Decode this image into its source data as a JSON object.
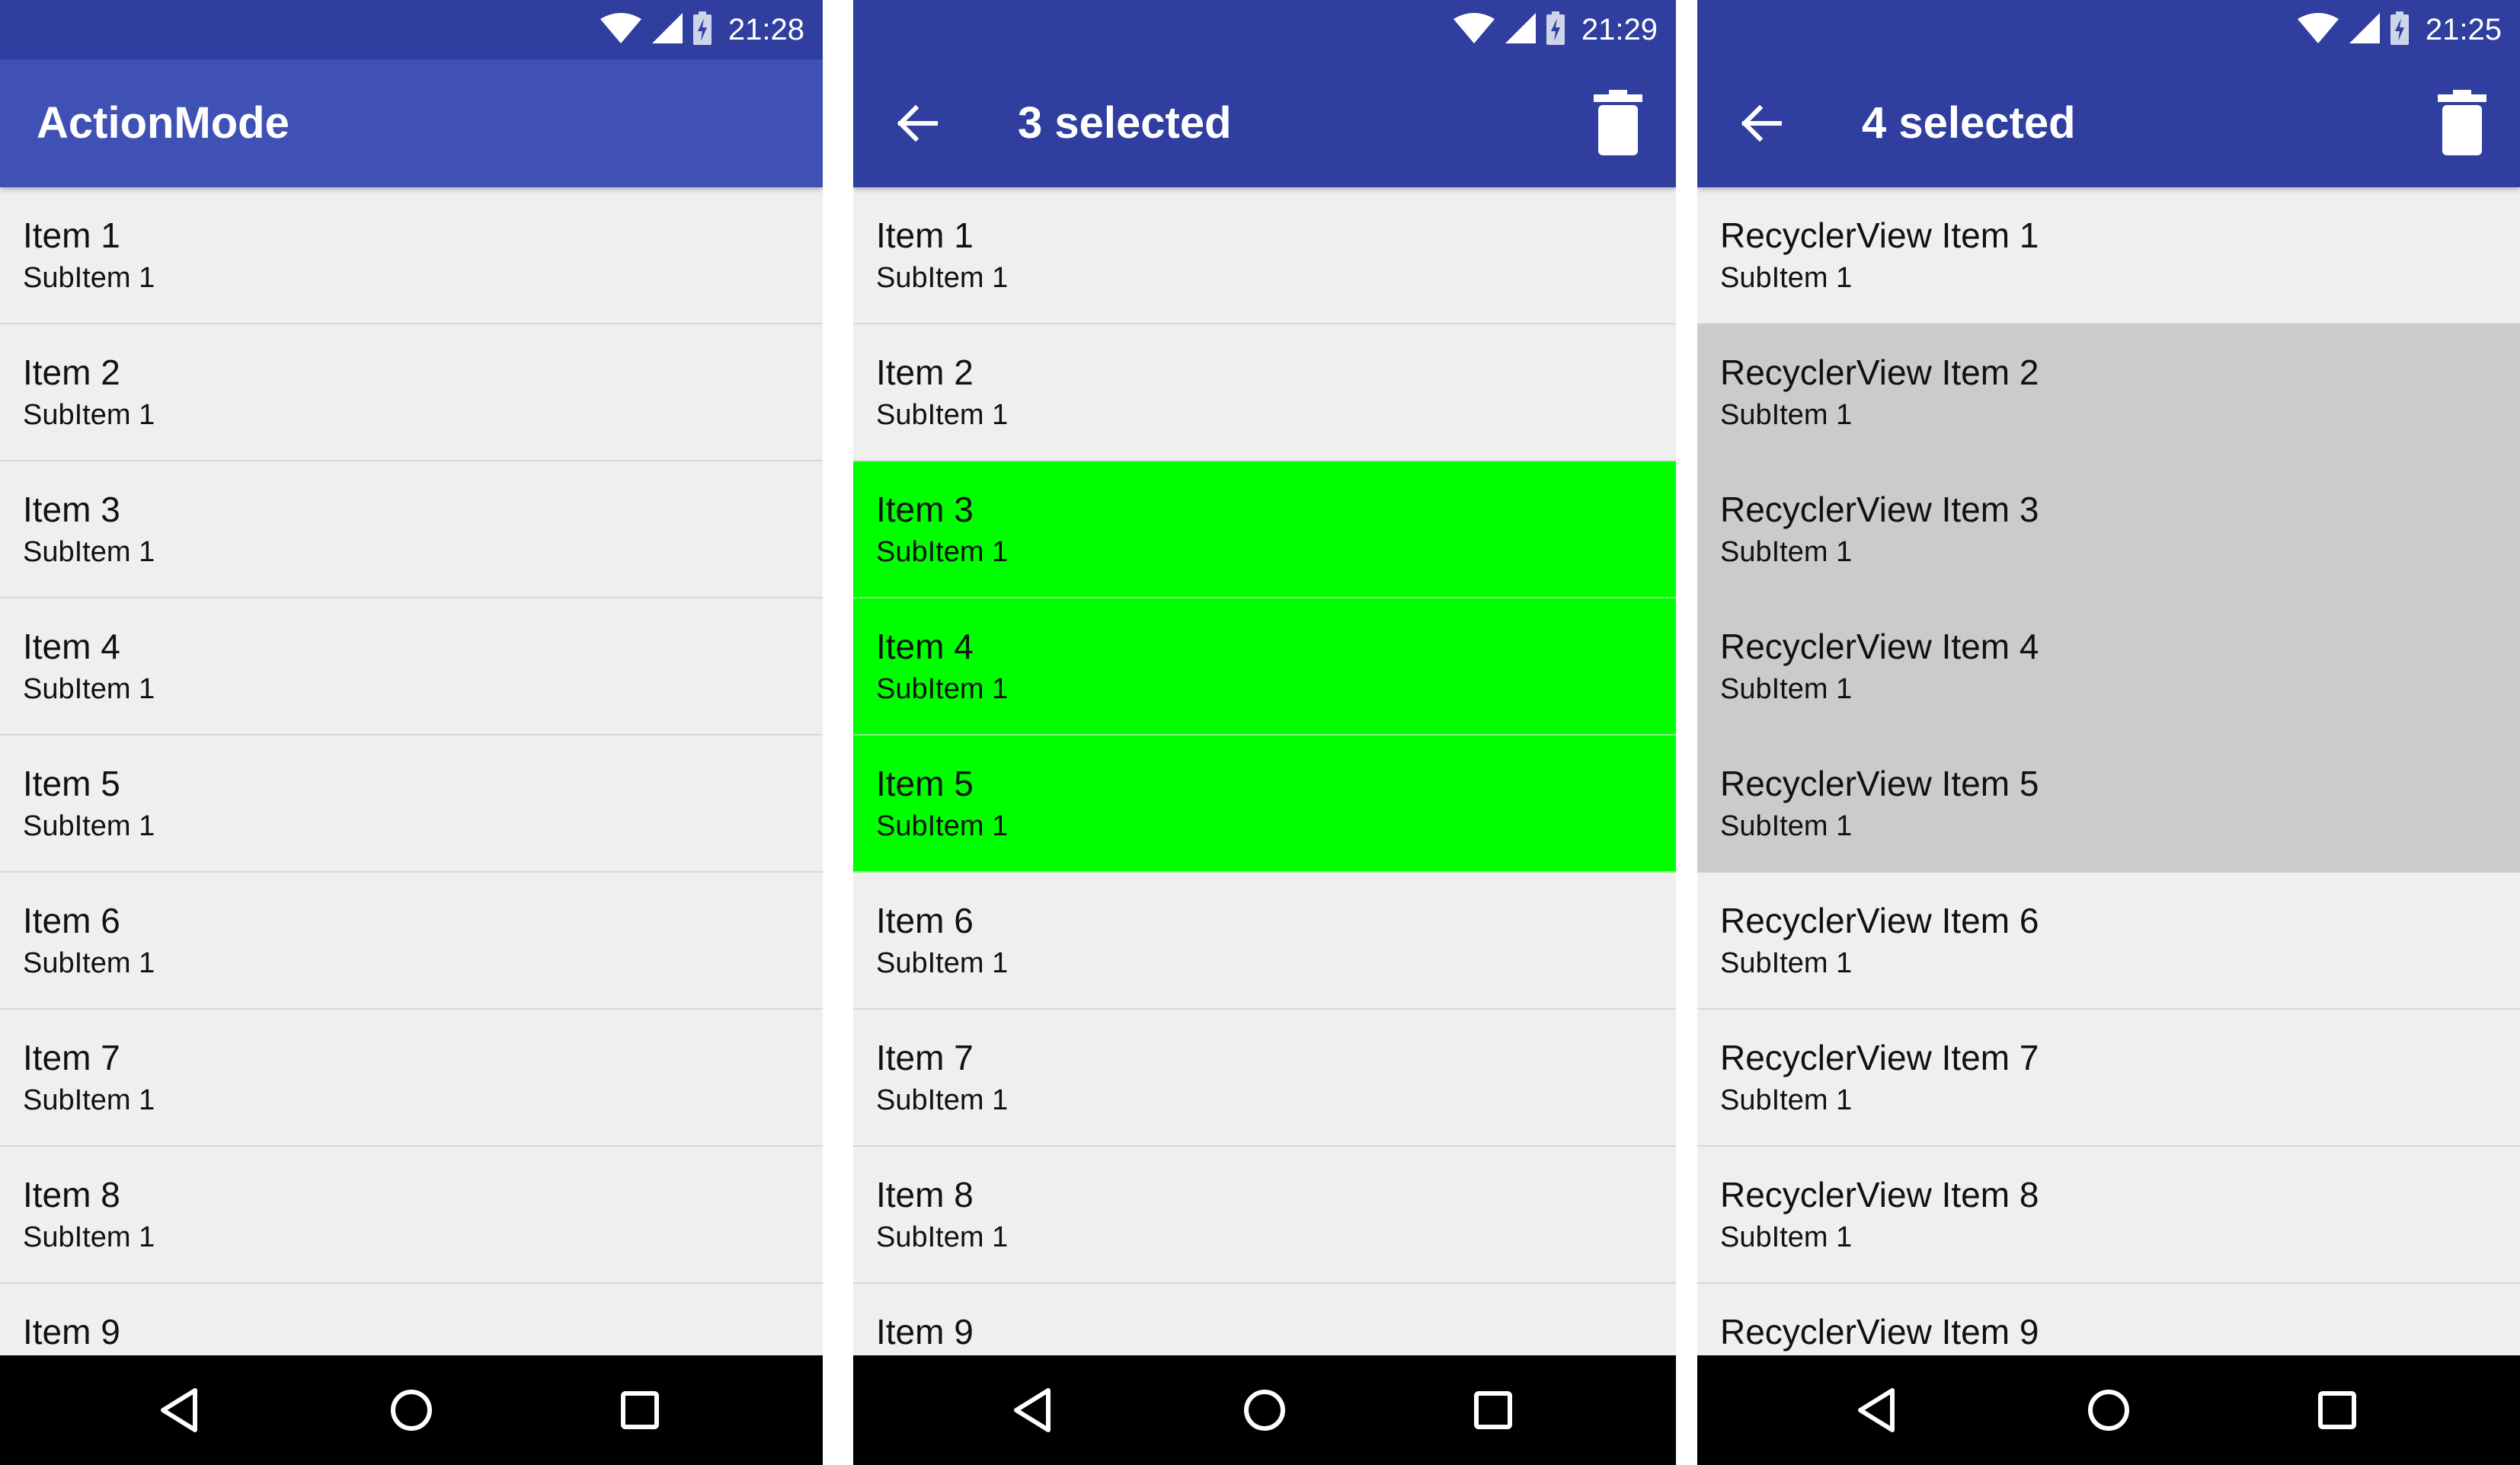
{
  "colors": {
    "status_bar": "#303f9f",
    "app_bar": "#3f51b5",
    "action_bar": "#303f9f",
    "list_background": "#efefef",
    "selected_green": "#00ff00",
    "selected_grey": "#cbcbcb",
    "nav_bar": "#000000"
  },
  "screens": [
    {
      "time": "21:28",
      "app_title": "ActionMode",
      "items": [
        {
          "title": "Item 1",
          "sub": "SubItem 1",
          "selected": false
        },
        {
          "title": "Item 2",
          "sub": "SubItem 1",
          "selected": false
        },
        {
          "title": "Item 3",
          "sub": "SubItem 1",
          "selected": false
        },
        {
          "title": "Item 4",
          "sub": "SubItem 1",
          "selected": false
        },
        {
          "title": "Item 5",
          "sub": "SubItem 1",
          "selected": false
        },
        {
          "title": "Item 6",
          "sub": "SubItem 1",
          "selected": false
        },
        {
          "title": "Item 7",
          "sub": "SubItem 1",
          "selected": false
        },
        {
          "title": "Item 8",
          "sub": "SubItem 1",
          "selected": false
        },
        {
          "title": "Item 9",
          "sub": "",
          "selected": false
        }
      ]
    },
    {
      "time": "21:29",
      "action_title": "3 selected",
      "items": [
        {
          "title": "Item 1",
          "sub": "SubItem 1",
          "selected": false
        },
        {
          "title": "Item 2",
          "sub": "SubItem 1",
          "selected": false
        },
        {
          "title": "Item 3",
          "sub": "SubItem 1",
          "selected": true
        },
        {
          "title": "Item 4",
          "sub": "SubItem 1",
          "selected": true
        },
        {
          "title": "Item 5",
          "sub": "SubItem 1",
          "selected": true
        },
        {
          "title": "Item 6",
          "sub": "SubItem 1",
          "selected": false
        },
        {
          "title": "Item 7",
          "sub": "SubItem 1",
          "selected": false
        },
        {
          "title": "Item 8",
          "sub": "SubItem 1",
          "selected": false
        },
        {
          "title": "Item 9",
          "sub": "",
          "selected": false
        }
      ]
    },
    {
      "time": "21:25",
      "action_title": "4 selected",
      "items": [
        {
          "title": "RecyclerView Item 1",
          "sub": "SubItem 1",
          "selected": false
        },
        {
          "title": "RecyclerView Item 2",
          "sub": "SubItem 1",
          "selected": true
        },
        {
          "title": "RecyclerView Item 3",
          "sub": "SubItem 1",
          "selected": true
        },
        {
          "title": "RecyclerView Item 4",
          "sub": "SubItem 1",
          "selected": true
        },
        {
          "title": "RecyclerView Item 5",
          "sub": "SubItem 1",
          "selected": true
        },
        {
          "title": "RecyclerView Item 6",
          "sub": "SubItem 1",
          "selected": false
        },
        {
          "title": "RecyclerView Item 7",
          "sub": "SubItem 1",
          "selected": false
        },
        {
          "title": "RecyclerView Item 8",
          "sub": "SubItem 1",
          "selected": false
        },
        {
          "title": "RecyclerView Item 9",
          "sub": "",
          "selected": false
        }
      ]
    }
  ],
  "icons": {
    "wifi": "wifi-icon",
    "signal": "cell-signal-icon",
    "battery": "battery-charging-icon",
    "back": "arrow-back-icon",
    "delete": "trash-icon",
    "nav_back": "nav-back-triangle-icon",
    "nav_home": "nav-home-circle-icon",
    "nav_recent": "nav-recents-square-icon"
  }
}
